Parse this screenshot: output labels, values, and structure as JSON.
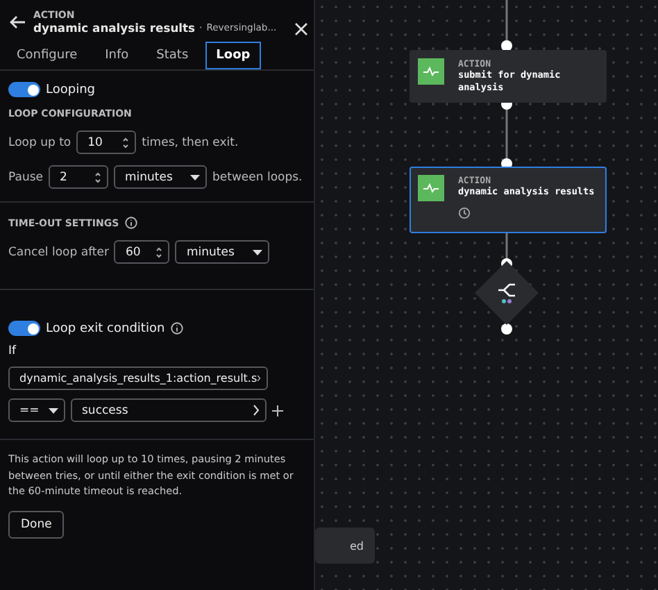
{
  "header": {
    "eyebrow": "ACTION",
    "title": "dynamic analysis results",
    "separator": "·",
    "subtitle": "Reversinglab..."
  },
  "tabs": [
    {
      "label": "Configure",
      "selected": false
    },
    {
      "label": "Info",
      "selected": false
    },
    {
      "label": "Stats",
      "selected": false
    },
    {
      "label": "Loop",
      "selected": true
    }
  ],
  "looping": {
    "label": "Looping",
    "on": true
  },
  "loop_configuration": {
    "heading": "LOOP CONFIGURATION",
    "loop_prefix": "Loop up to",
    "count": "10",
    "loop_suffix": "times, then exit.",
    "pause_prefix": "Pause",
    "pause": "2",
    "pause_unit": "minutes",
    "pause_suffix": "between loops."
  },
  "timeout": {
    "heading": "TIME-OUT SETTINGS",
    "prefix": "Cancel loop after",
    "value": "60",
    "unit": "minutes"
  },
  "exit_condition": {
    "label": "Loop exit condition",
    "on": true,
    "if_label": "If",
    "field": "dynamic_analysis_results_1:action_result.s",
    "operator": "==",
    "value": "success"
  },
  "summary": "This action will loop up to 10 times, pausing 2 minutes between tries, or until either the exit condition is met or the 60-minute timeout is reached.",
  "done": "Done",
  "canvas": {
    "nodes": [
      {
        "eyebrow": "ACTION",
        "title": "submit for dynamic analysis",
        "selected": false,
        "looping": false
      },
      {
        "eyebrow": "ACTION",
        "title": "dynamic analysis results",
        "selected": true,
        "looping": true
      }
    ],
    "partial_card": "ed"
  }
}
